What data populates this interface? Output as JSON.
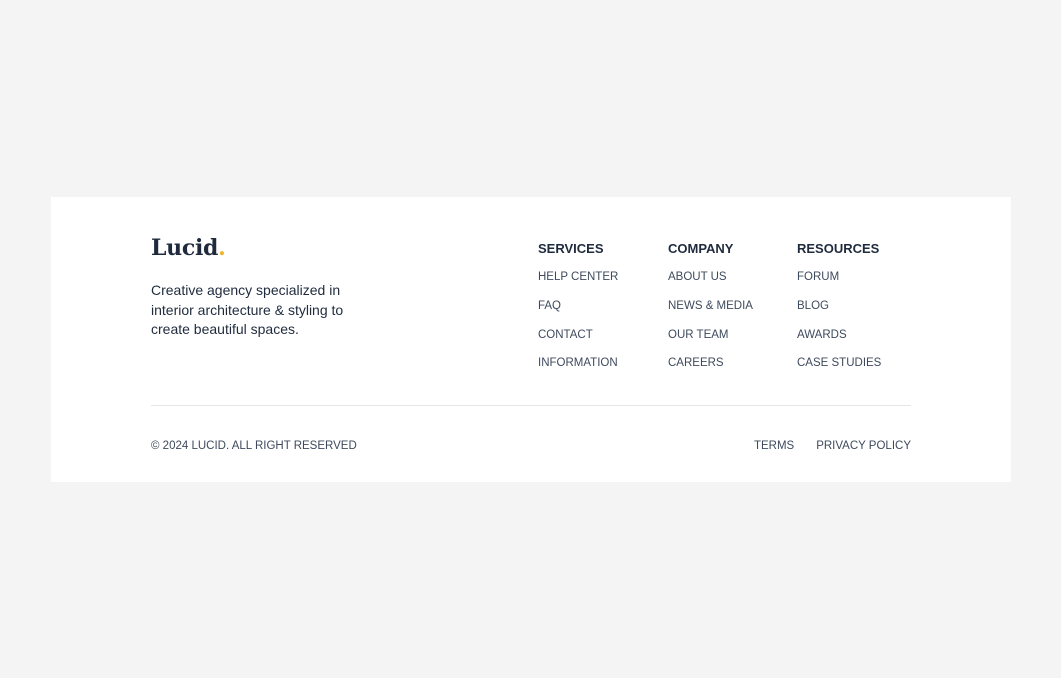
{
  "brand": {
    "logo_text": "Lucid",
    "logo_dot": ".",
    "tagline": "Creative agency specialized in interior architecture & styling to create beautiful spaces."
  },
  "columns": [
    {
      "title": "SERVICES",
      "links": [
        "HELP CENTER",
        "FAQ",
        "CONTACT",
        "INFORMATION"
      ]
    },
    {
      "title": "COMPANY",
      "links": [
        "ABOUT US",
        "NEWS & MEDIA",
        "OUR TEAM",
        "CAREERS"
      ]
    },
    {
      "title": "RESOURCES",
      "links": [
        "FORUM",
        "BLOG",
        "AWARDS",
        "CASE STUDIES"
      ]
    }
  ],
  "bottom": {
    "copyright": "© 2024 LUCID. ALL RIGHT RESERVED",
    "legal_links": [
      "TERMS",
      "PRIVACY POLICY"
    ]
  },
  "colors": {
    "page_background": "#f4f4f4",
    "card_background": "#ffffff",
    "text_dark": "#1f2b3d",
    "accent": "#f0b429"
  }
}
